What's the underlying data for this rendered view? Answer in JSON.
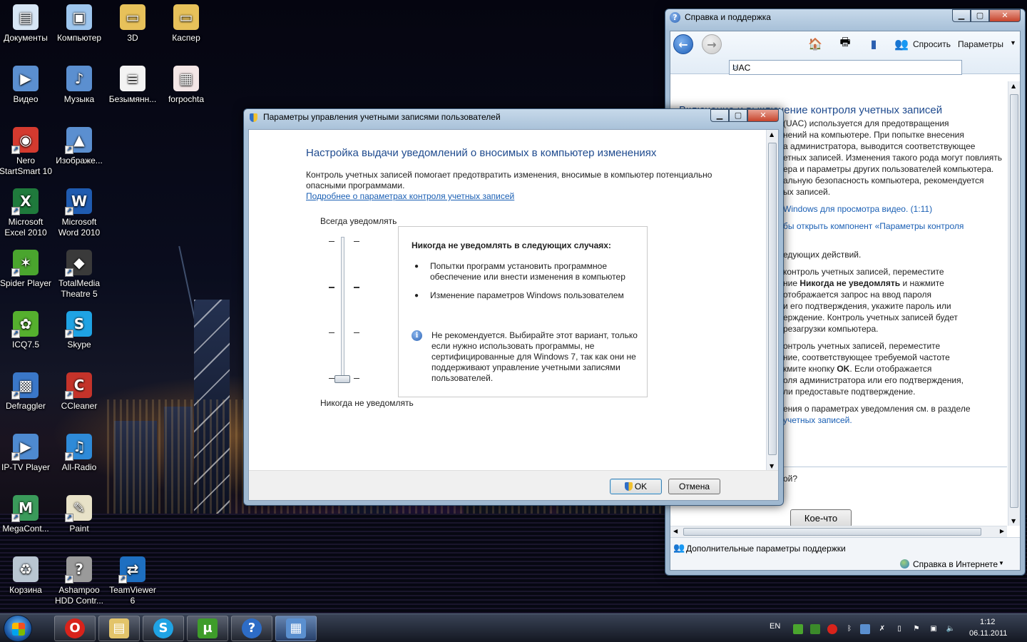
{
  "desktop": {
    "icons": [
      {
        "label": "Документы",
        "icon": "documents-icon",
        "color": "#d7e6f5"
      },
      {
        "label": "Компьютер",
        "icon": "computer-icon",
        "color": "#9ec6ee"
      },
      {
        "label": "3D",
        "icon": "folder-icon",
        "color": "#e7c15a"
      },
      {
        "label": "Каспер",
        "icon": "folder-icon",
        "color": "#e7c15a"
      },
      {
        "label": "Видео",
        "icon": "video-library-icon",
        "color": "#5b8fd0"
      },
      {
        "label": "Музыка",
        "icon": "music-library-icon",
        "color": "#5b8fd0"
      },
      {
        "label": "Безымянн...",
        "icon": "document-file-icon",
        "color": "#f3f3f3"
      },
      {
        "label": "forpochta",
        "icon": "image-file-icon",
        "color": "#f3e6e6"
      },
      {
        "label": "Nero\nStartSmart 10",
        "icon": "nero-icon",
        "color": "#d43a2f"
      },
      {
        "label": "Изображе...",
        "icon": "pictures-icon",
        "color": "#5b8fd0"
      },
      {
        "label": "Microsoft\nExcel 2010",
        "icon": "excel-icon",
        "color": "#1f7a3c"
      },
      {
        "label": "Microsoft\nWord 2010",
        "icon": "word-icon",
        "color": "#1f5bb0"
      },
      {
        "label": "Spider Player",
        "icon": "spider-player-icon",
        "color": "#4aa52e"
      },
      {
        "label": "TotalMedia\nTheatre 5",
        "icon": "totalmedia-icon",
        "color": "#3a3a3a"
      },
      {
        "label": "ICQ7.5",
        "icon": "icq-icon",
        "color": "#55b02e"
      },
      {
        "label": "Skype",
        "icon": "skype-icon",
        "color": "#1fa3e4"
      },
      {
        "label": "Defraggler",
        "icon": "defraggler-icon",
        "color": "#3a77c8"
      },
      {
        "label": "CCleaner",
        "icon": "ccleaner-icon",
        "color": "#c4332a"
      },
      {
        "label": "IP-TV Player",
        "icon": "iptv-icon",
        "color": "#4e8ad0"
      },
      {
        "label": "All-Radio",
        "icon": "all-radio-icon",
        "color": "#2e8ad8"
      },
      {
        "label": "MegaCont...",
        "icon": "megacont-icon",
        "color": "#3a9a5a"
      },
      {
        "label": "Paint",
        "icon": "paint-icon",
        "color": "#e8e2c8"
      },
      {
        "label": "Корзина",
        "icon": "recycle-bin-icon",
        "color": "#b9c6d2"
      },
      {
        "label": "Ashampoo\nHDD Contr...",
        "icon": "ashampoo-icon",
        "color": "#9a9a9a"
      },
      {
        "label": "TeamViewer\n6",
        "icon": "teamviewer-icon",
        "color": "#1e6fc1"
      }
    ]
  },
  "help_window": {
    "title": "Справка и поддержка",
    "toolbar": {
      "ask_label": "Спросить",
      "options_label": "Параметры"
    },
    "search": {
      "value": "UAC"
    },
    "heading": "Включение и выключение контроля учетных записей",
    "lines": [
      {
        "text": "(UAC) используется для предотвращения",
        "link": false
      },
      {
        "text": "нений на компьютере. При попытке внесения",
        "link": false
      },
      {
        "text": "а администратора, выводится соответствующее",
        "link": false
      },
      {
        "text": "етных записей. Изменения такого рода могут повлиять",
        "link": false
      },
      {
        "text": "ера и параметры других пользователей компьютера.",
        "link": false
      },
      {
        "text": "альную безопасность компьютера, рекомендуется",
        "link": false
      },
      {
        "text": "ых записей.",
        "link": false
      },
      {
        "text": "Windows для просмотра видео. (1:11)",
        "link": true
      },
      {
        "text": "бы открыть компонент «Параметры контроля",
        "link": true
      },
      {
        "text": "едующих действий.",
        "link": false
      },
      {
        "text": "контроль учетных записей, переместите",
        "link": false
      },
      {
        "text_html": "ние <b>Никогда не уведомлять</b> и нажмите",
        "link": false
      },
      {
        "text": "отображается запрос на ввод пароля",
        "link": false
      },
      {
        "text": "и его подтверждения, укажите пароль или",
        "link": false
      },
      {
        "text": "ерждение. Контроль учетных записей будет",
        "link": false
      },
      {
        "text": "резагрузки компьютера.",
        "link": false
      },
      {
        "text": "онтроль учетных записей, переместите",
        "link": false
      },
      {
        "text": "ние, соответствующее требуемой частоте",
        "link": false
      },
      {
        "text_html": "кмите кнопку <b>OK</b>. Если отображается",
        "link": false
      },
      {
        "text": "оля администратора или его подтверждения,",
        "link": false
      },
      {
        "text": "ли предоставьте подтверждение.",
        "link": false
      },
      {
        "text": "ения о параметрах уведомления см. в разделе",
        "link": false
      },
      {
        "text": "учетных записей.",
        "link": true
      }
    ],
    "question_fragment": "ой?",
    "something_button": "Кое-что",
    "footer": {
      "additional_support": "Дополнительные параметры поддержки",
      "online_help": "Справка в Интернете"
    }
  },
  "uac_dialog": {
    "title": "Параметры управления учетными записями пользователей",
    "heading": "Настройка выдачи уведомлений о вносимых в компьютер изменениях",
    "description": "Контроль учетных записей помогает предотвратить изменения, вносимые в компьютер потенциально опасными программами.",
    "learn_more_link": "Подробнее о параметрах контроля учетных записей",
    "slider": {
      "top_label": "Всегда уведомлять",
      "bottom_label": "Никогда не уведомлять",
      "levels": 4,
      "selected_level": 1
    },
    "level_description": {
      "header": "Никогда не уведомлять в следующих случаях:",
      "bullets": [
        "Попытки программ установить программное обеспечение или внести изменения в компьютер",
        "Изменение параметров Windows пользователем"
      ],
      "note": "Не рекомендуется. Выбирайте этот вариант, только если нужно использовать программы, не сертифицированные для Windows 7, так как они не поддерживают управление учетными записями пользователей."
    },
    "ok_button": "OK",
    "cancel_button": "Отмена"
  },
  "taskbar": {
    "pinned": [
      {
        "name": "opera",
        "icon": "opera-icon",
        "glyph": "O",
        "color": "#d8231b"
      },
      {
        "name": "explorer",
        "icon": "explorer-folder-icon",
        "glyph": "▤",
        "color": "#e3c46a"
      },
      {
        "name": "skype",
        "icon": "skype-icon",
        "glyph": "S",
        "color": "#1fa3e4"
      },
      {
        "name": "utorrent",
        "icon": "utorrent-icon",
        "glyph": "µ",
        "color": "#3e9c2a"
      },
      {
        "name": "help",
        "icon": "help-icon",
        "glyph": "?",
        "color": "#2d6cc6"
      },
      {
        "name": "control-panel",
        "icon": "control-panel-icon",
        "glyph": "▦",
        "color": "#5a8fcf"
      }
    ],
    "language": "EN",
    "time": "1:12",
    "date": "06.11.2011"
  }
}
